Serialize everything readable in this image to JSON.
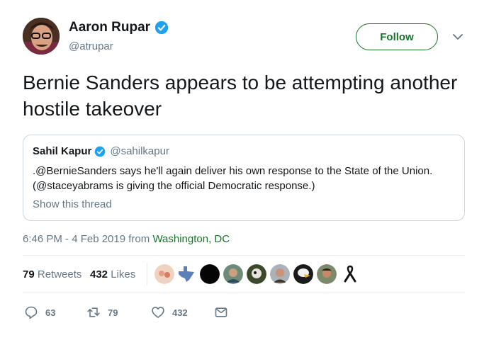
{
  "author": {
    "name": "Aaron Rupar",
    "handle": "@atrupar",
    "verified": true
  },
  "follow_label": "Follow",
  "tweet_text": "Bernie Sanders appears to be attempting another hostile takeover",
  "quoted": {
    "name": "Sahil Kapur",
    "handle": "@sahilkapur",
    "verified": true,
    "body": ".@BernieSanders says he'll again deliver his own response to the State of the Union. (@staceyabrams is giving the official Democratic response.)",
    "thread_link": "Show this thread"
  },
  "timestamp": {
    "time": "6:46 PM - 4 Feb 2019",
    "from": "from",
    "location": "Washington, DC"
  },
  "stats": {
    "retweets_count": "79",
    "retweets_label": "Retweets",
    "likes_count": "432",
    "likes_label": "Likes"
  },
  "actions": {
    "reply": "63",
    "retweet": "79",
    "like": "432"
  },
  "colors": {
    "accent_green": "#17752b",
    "verified_blue": "#1da1f2",
    "secondary_text": "#657786"
  },
  "icons": [
    "verified-badge-icon",
    "chevron-down-icon",
    "reply-icon",
    "retweet-icon",
    "like-icon",
    "message-icon"
  ]
}
